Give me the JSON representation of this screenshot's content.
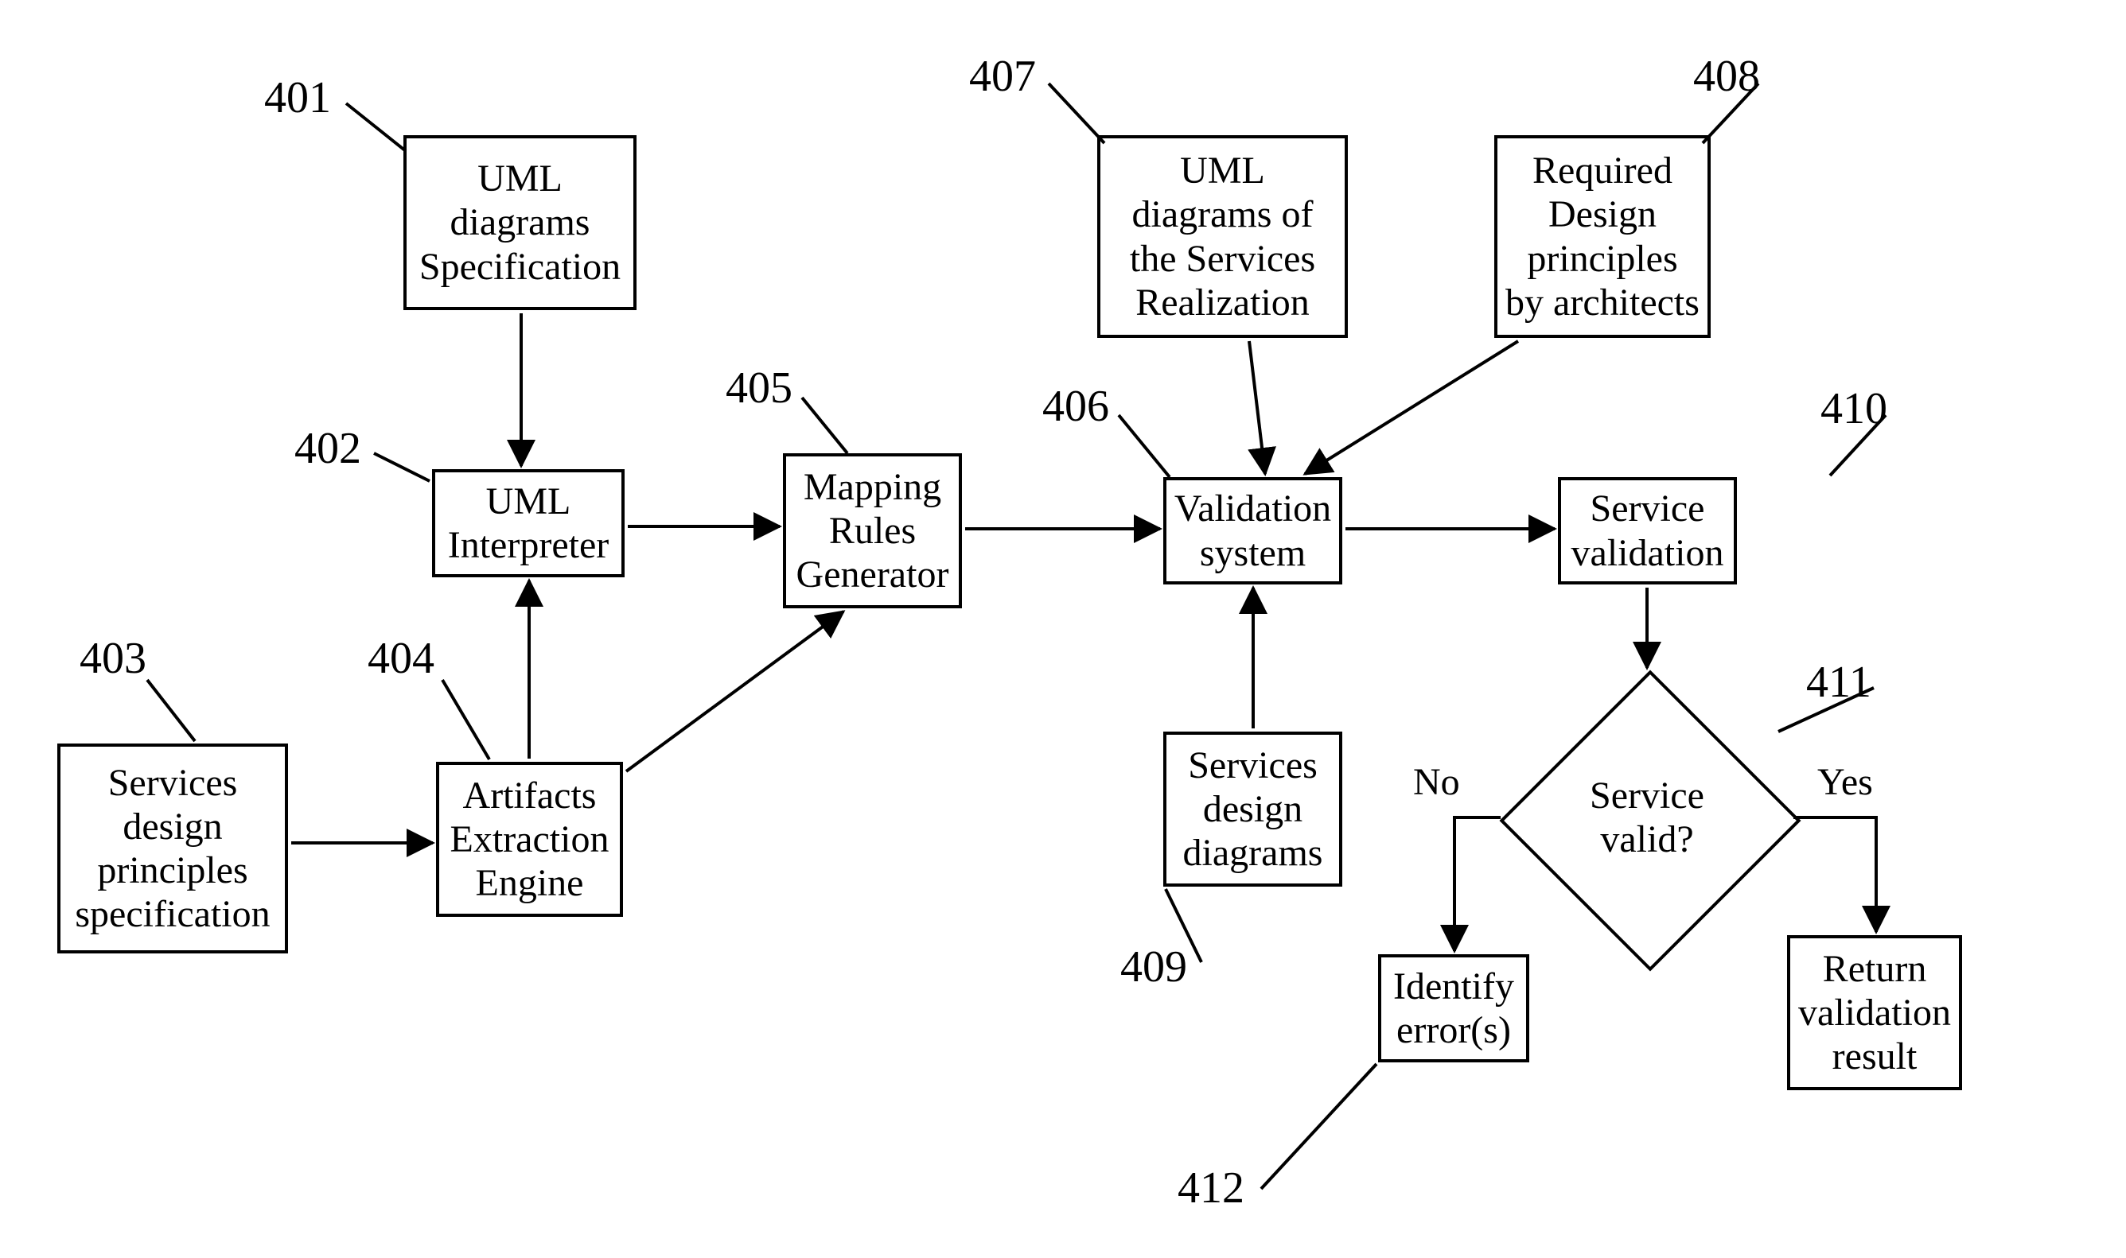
{
  "boxes": {
    "b401": "UML diagrams Specification",
    "b402": "UML Interpreter",
    "b403": "Services design principles specification",
    "b404": "Artifacts Extraction Engine",
    "b405": "Mapping Rules Generator",
    "b406": "Validation system",
    "b407": "UML diagrams of the Services Realization",
    "b408": "Required Design principles by architects",
    "b409": "Services design diagrams",
    "b410": "Service validation",
    "b411": "Service valid?",
    "b412": "Identify error(s)",
    "b413": "Return validation result"
  },
  "labels": {
    "l401": "401",
    "l402": "402",
    "l403": "403",
    "l404": "404",
    "l405": "405",
    "l406": "406",
    "l407": "407",
    "l408": "408",
    "l409": "409",
    "l410": "410",
    "l411": "411",
    "l412": "412",
    "lNo": "No",
    "lYes": "Yes"
  }
}
